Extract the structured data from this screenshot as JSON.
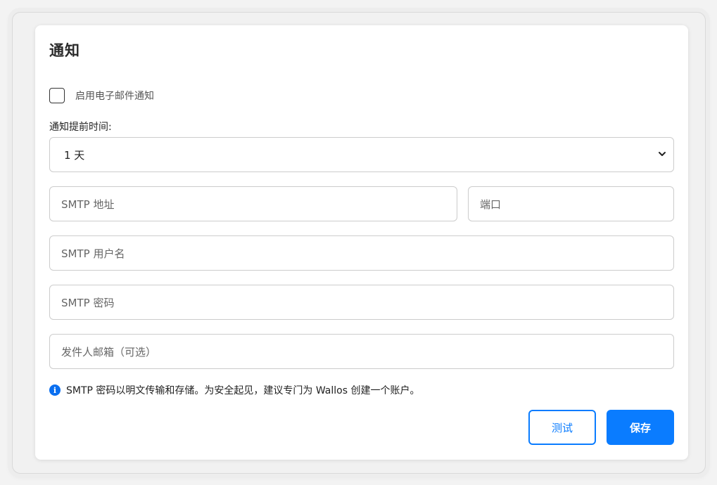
{
  "notification": {
    "title": "通知",
    "enable_email_label": "启用电子邮件通知",
    "enable_email_checked": false,
    "days_before_label": "通知提前时间:",
    "days_before_selected": "1 天",
    "smtp_address_placeholder": "SMTP 地址",
    "port_placeholder": "端口",
    "smtp_username_placeholder": "SMTP 用户名",
    "smtp_password_placeholder": "SMTP 密码",
    "from_email_placeholder": "发件人邮箱（可选）",
    "info_text": "SMTP 密码以明文传输和存储。为安全起见，建议专门为 Wallos 创建一个账户。",
    "test_button": "测试",
    "save_button": "保存"
  },
  "colors": {
    "primary": "#0a7cff",
    "info_icon": "#0a6ff0"
  },
  "icons": {
    "info": "info-icon",
    "select_arrow": "chevron-down-icon"
  }
}
